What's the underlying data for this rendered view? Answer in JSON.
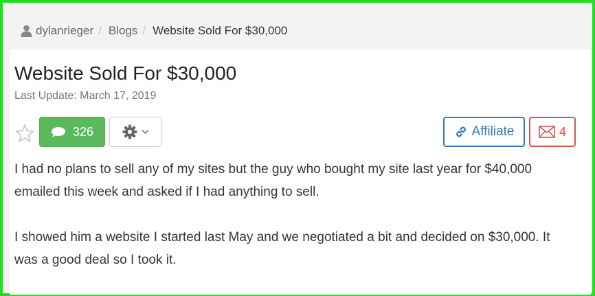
{
  "breadcrumb": {
    "user": "dylanrieger",
    "section": "Blogs",
    "current": "Website Sold For $30,000",
    "separator": "/"
  },
  "post": {
    "title": "Website Sold For $30,000",
    "last_update": "Last Update: March 17, 2019",
    "paragraphs": [
      "I had no plans to sell any of my sites but the guy who bought my site last year for $40,000 emailed this week and asked if I had anything to sell.",
      "I showed him a website I started last May and we negotiated a bit and decided on $30,000. It was a good deal so I took it."
    ]
  },
  "toolbar": {
    "comment_count": "326",
    "affiliate_label": "Affiliate",
    "mail_count": "4"
  },
  "colors": {
    "frame_border": "#22dd22",
    "comment_button": "#5cb85c",
    "affiliate": "#337ab7",
    "mail": "#d9534f"
  },
  "icons": [
    "user-icon",
    "star-icon",
    "comment-bubble-icon",
    "gear-icon",
    "chevron-down-icon",
    "link-icon",
    "envelope-icon"
  ]
}
